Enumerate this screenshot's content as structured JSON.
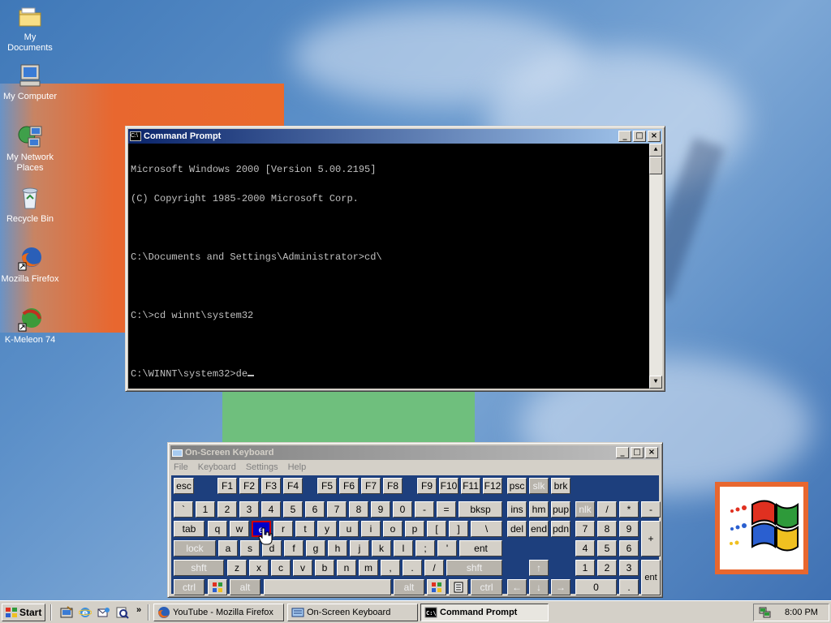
{
  "desktop": {
    "icons": [
      {
        "label": "My Documents",
        "icon": "folder-icon"
      },
      {
        "label": "My Computer",
        "icon": "computer-icon"
      },
      {
        "label": "My Network Places",
        "icon": "network-icon"
      },
      {
        "label": "Recycle Bin",
        "icon": "recycle-bin-icon"
      },
      {
        "label": "Mozilla Firefox",
        "icon": "firefox-icon"
      },
      {
        "label": "K-Meleon 74",
        "icon": "kmeleon-icon"
      }
    ]
  },
  "cmd": {
    "title": "Command Prompt",
    "lines": [
      "Microsoft Windows 2000 [Version 5.00.2195]",
      "(C) Copyright 1985-2000 Microsoft Corp.",
      "",
      "C:\\Documents and Settings\\Administrator>cd\\",
      "",
      "C:\\>cd winnt\\system32",
      "",
      "C:\\WINNT\\system32>de"
    ]
  },
  "osk": {
    "title": "On-Screen Keyboard",
    "menu": [
      "File",
      "Keyboard",
      "Settings",
      "Help"
    ],
    "keys": {
      "esc": "esc",
      "f1": "F1",
      "f2": "F2",
      "f3": "F3",
      "f4": "F4",
      "f5": "F5",
      "f6": "F6",
      "f7": "F7",
      "f8": "F8",
      "f9": "F9",
      "f10": "F10",
      "f11": "F11",
      "f12": "F12",
      "psc": "psc",
      "slk": "slk",
      "brk": "brk",
      "grave": "`",
      "n1": "1",
      "n2": "2",
      "n3": "3",
      "n4": "4",
      "n5": "5",
      "n6": "6",
      "n7": "7",
      "n8": "8",
      "n9": "9",
      "n0": "0",
      "minus": "-",
      "equals": "=",
      "bksp": "bksp",
      "ins": "ins",
      "hm": "hm",
      "pup": "pup",
      "nlk": "nlk",
      "kslash": "/",
      "kstar": "*",
      "kminus": "-",
      "tab": "tab",
      "q": "q",
      "w": "w",
      "e": "e",
      "r": "r",
      "t": "t",
      "y": "y",
      "u": "u",
      "i": "i",
      "o": "o",
      "p": "p",
      "lbr": "[",
      "rbr": "]",
      "bslash": "\\",
      "del": "del",
      "end": "end",
      "pdn": "pdn",
      "k7": "7",
      "k8": "8",
      "k9": "9",
      "kplus": "+",
      "lock": "lock",
      "a": "a",
      "s": "s",
      "d": "d",
      "f": "f",
      "g": "g",
      "h": "h",
      "j": "j",
      "k": "k",
      "l": "l",
      "semi": ";",
      "quote": "'",
      "ent": "ent",
      "k4": "4",
      "k5": "5",
      "k6": "6",
      "shft": "shft",
      "z": "z",
      "x": "x",
      "c": "c",
      "v": "v",
      "b": "b",
      "n": "n",
      "m": "m",
      "comma": ",",
      "period": ".",
      "slash": "/",
      "shft2": "shft",
      "up": "↑",
      "k1": "1",
      "k2": "2",
      "k3": "3",
      "ctrl": "ctrl",
      "alt": "alt",
      "alt2": "alt",
      "ctrl2": "ctrl",
      "left": "←",
      "down": "↓",
      "right": "→",
      "k0": "0",
      "kdot": ".",
      "kent": "ent"
    }
  },
  "taskbar": {
    "start": "Start",
    "tasks": [
      "YouTube - Mozilla Firefox",
      "On-Screen Keyboard",
      "Command Prompt"
    ],
    "chevron": "»",
    "clock": "8:00 PM"
  }
}
